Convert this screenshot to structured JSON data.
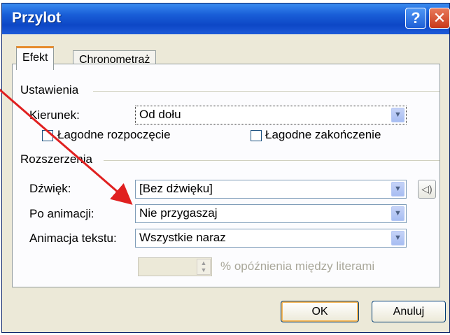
{
  "window": {
    "title": "Przylot",
    "help_glyph": "?",
    "close_glyph": "✕"
  },
  "tabs": [
    {
      "label": "Efekt",
      "active": true
    },
    {
      "label": "Chronometraż",
      "active": false
    }
  ],
  "settings": {
    "group_label": "Ustawienia",
    "direction": {
      "label": "Kierunek:",
      "value": "Od dołu"
    },
    "smooth_start": {
      "label": "Łagodne rozpoczęcie",
      "checked": false
    },
    "smooth_end": {
      "label": "Łagodne zakończenie",
      "checked": false
    }
  },
  "enhancements": {
    "group_label": "Rozszerzenia",
    "sound": {
      "label": "Dźwięk:",
      "value": "[Bez dźwięku]"
    },
    "after_animation": {
      "label": "Po animacji:",
      "value": "Nie przygaszaj"
    },
    "text_animation": {
      "label": "Animacja tekstu:",
      "value": "Wszystkie naraz"
    },
    "delay": {
      "value": "",
      "suffix": "% opóźnienia między literami"
    }
  },
  "buttons": {
    "ok": "OK",
    "cancel": "Anuluj"
  },
  "icons": {
    "dropdown": "chevron-down-icon",
    "sound": "speaker-icon",
    "spinner": "spin-arrows-icon"
  },
  "colors": {
    "title_bar": "#1a5fd8",
    "annotation_arrow": "#e02020",
    "active_tab_accent": "#e68b2c"
  }
}
